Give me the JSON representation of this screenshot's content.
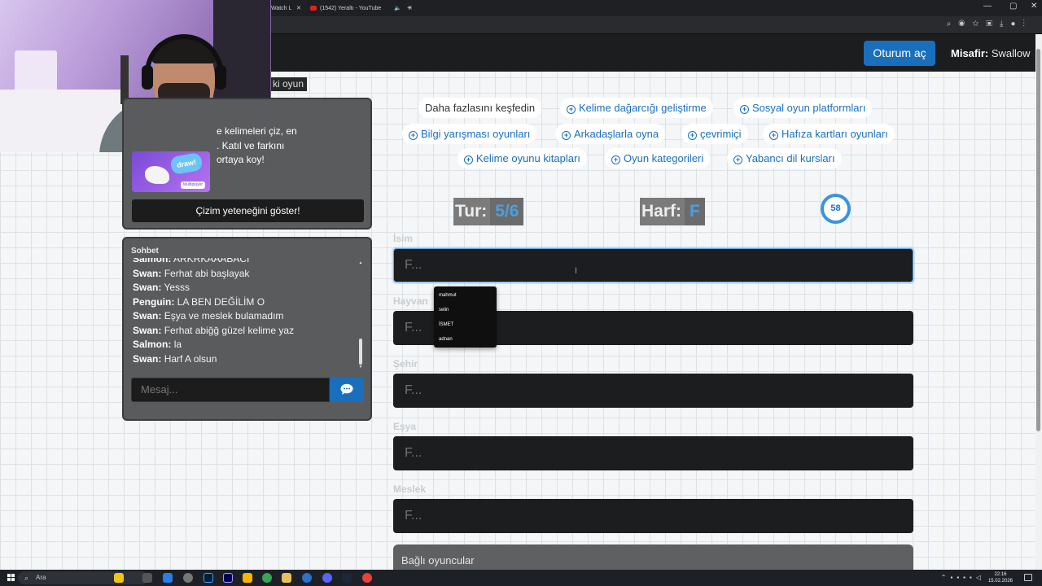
{
  "browser": {
    "tabs": [
      {
        "title": "Watch L",
        "close": "✕"
      },
      {
        "title": "(1542) Yeraltı - YouTube",
        "close": "✕"
      }
    ],
    "new_tab": "+",
    "window_controls": [
      "—",
      "▢",
      "✕"
    ]
  },
  "header": {
    "login_label": "Oturum aç",
    "guest_prefix": "Misafir:",
    "guest_name": "Swallow"
  },
  "sidebar_title": "ki oyun",
  "promo": {
    "image_text": "draw!",
    "image_tag": "Multiplayer",
    "text": "e kelimeleri çiz, en\n. Katıl ve farkını\nortaya koy!",
    "button": "Çizim yeteneğini göster!"
  },
  "chat": {
    "title": "Sohbet",
    "messages": [
      {
        "user": "Salmon:",
        "text": "ARKRKAAABACI"
      },
      {
        "user": "Swan:",
        "text": "Ferhat abi başlayak"
      },
      {
        "user": "Swan:",
        "text": "Yesss"
      },
      {
        "user": "Penguin:",
        "text": "LA BEN DEĞİLİM O"
      },
      {
        "user": "Swan:",
        "text": "Eşya ve meslek bulamadım"
      },
      {
        "user": "Swan:",
        "text": "Ferhat abiğğ güzel kelime yaz"
      },
      {
        "user": "Salmon:",
        "text": "la"
      },
      {
        "user": "Swan:",
        "text": "Harf A olsun"
      }
    ],
    "input_placeholder": "Mesaj..."
  },
  "discover": {
    "label": "Daha fazlasını keşfedin",
    "links": [
      "Kelime dağarcığı geliştirme",
      "Sosyal oyun platformları",
      "Bilgi yarışması oyunları",
      "Arkadaşlarla oyna",
      "çevrimiçi",
      "Hafıza kartları oyunları",
      "Kelime oyunu kitapları",
      "Oyun kategorileri",
      "Yabancı dil kursları"
    ]
  },
  "game": {
    "round_label": "Tur:",
    "round_value": "5/6",
    "letter_label": "Harf:",
    "letter_value": "F",
    "timer": "58"
  },
  "fields": [
    {
      "label": "İsim",
      "placeholder": "F..."
    },
    {
      "label": "Hayvan",
      "placeholder": "F..."
    },
    {
      "label": "Şehir",
      "placeholder": "F..."
    },
    {
      "label": "Eşya",
      "placeholder": "F..."
    },
    {
      "label": "Meslek",
      "placeholder": "F..."
    }
  ],
  "autocomplete": [
    "mahmut",
    "selin",
    "İSMET",
    "adnan"
  ],
  "connected_players": "Bağlı oyuncular",
  "taskbar": {
    "search": "Ara",
    "time": "22:16",
    "date": "15.02.2026"
  },
  "colors": {
    "accent": "#1a6fbd",
    "header_bg": "#1b1d1f",
    "input_bg": "#1c1d1e",
    "panel_bg": "#5a5b5c"
  }
}
